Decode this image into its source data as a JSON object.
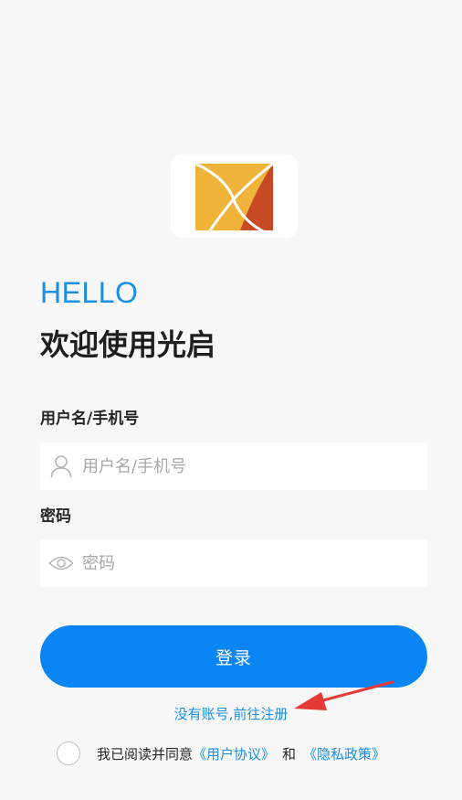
{
  "header": {
    "greeting": "HELLO",
    "welcome": "欢迎使用光启"
  },
  "form": {
    "username": {
      "label": "用户名/手机号",
      "placeholder": "用户名/手机号",
      "value": "",
      "icon": "user-icon"
    },
    "password": {
      "label": "密码",
      "placeholder": "密码",
      "value": "",
      "icon": "eye-icon"
    },
    "login_label": "登录",
    "register_link": "没有账号,前往注册"
  },
  "agreement": {
    "text": "我已阅读并同意",
    "user_agreement": "《用户协议》",
    "and": "和",
    "privacy_policy": "《隐私政策》",
    "checked": false
  },
  "colors": {
    "accent": "#0a86f4",
    "link": "#1a8fe3",
    "annotation_arrow": "#e53935",
    "logo_yellow": "#f0b43a",
    "logo_orange": "#c84a25"
  }
}
